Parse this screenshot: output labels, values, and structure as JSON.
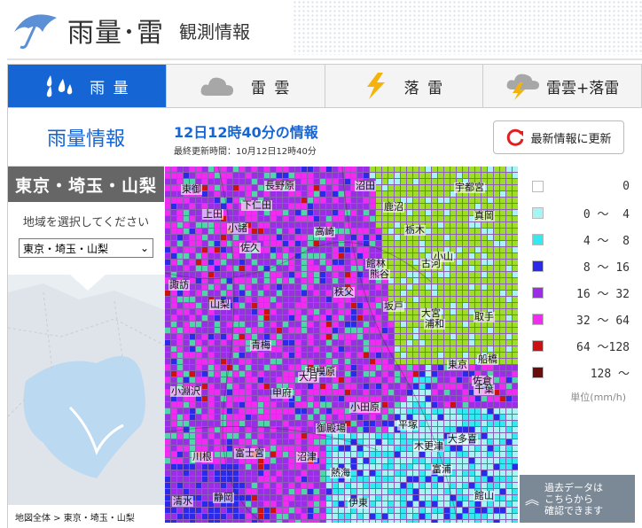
{
  "header": {
    "title": "雨量･雷",
    "subtitle": "観測情報"
  },
  "tabs": [
    {
      "label": "雨 量",
      "icon": "rain-drops-icon",
      "active": true
    },
    {
      "label": "雷 雲",
      "icon": "cloud-icon",
      "active": false
    },
    {
      "label": "落 雷",
      "icon": "lightning-icon",
      "active": false
    },
    {
      "label": "雷雲+落雷",
      "icon": "cloud-lightning-icon",
      "active": false
    }
  ],
  "sidebar": {
    "title": "雨量情報",
    "region": "東京・埼玉・山梨",
    "choose_label": "地域を選択してください",
    "select_value": "東京・埼玉・山梨",
    "breadcrumb": "地図全体 > 東京・埼玉・山梨"
  },
  "info": {
    "datetime": "12日12時40分の情報",
    "updated": "最終更新時間：10月12日12時40分",
    "refresh_label": "最新情報に更新"
  },
  "map_places": [
    "東御",
    "長野原",
    "沼田",
    "宇都宮",
    "上田",
    "下仁田",
    "鹿沼",
    "真岡",
    "小諸",
    "佐久",
    "高崎",
    "栃木",
    "小山",
    "古河",
    "館林",
    "熊谷",
    "諏訪",
    "秩父",
    "坂戸",
    "取手",
    "大宮",
    "浦和",
    "船橋",
    "佐倉",
    "山梨",
    "青梅",
    "東京",
    "千葉",
    "富士宮",
    "相模原",
    "小田原",
    "平塚",
    "御殿場",
    "沼津",
    "熱海",
    "清水",
    "静岡",
    "伊東",
    "富浦",
    "館山",
    "川根",
    "大月",
    "甲府",
    "大多喜",
    "小淵沢",
    "木更津"
  ],
  "legend": {
    "items": [
      {
        "label": "0",
        "color": "#ffffff"
      },
      {
        "label": "0 ～  4",
        "color": "#a8f4f4"
      },
      {
        "label": "4 ～  8",
        "color": "#33e8ee"
      },
      {
        "label": "8 ～ 16",
        "color": "#2a2ae8"
      },
      {
        "label": "16 ～ 32",
        "color": "#9b2de6"
      },
      {
        "label": "32 ～ 64",
        "color": "#f02cf0"
      },
      {
        "label": "64 ～128",
        "color": "#cc1111"
      },
      {
        "label": "128 ～",
        "color": "#6a0d0d"
      }
    ],
    "unit": "単位(mm/h)",
    "past_data_label": "過去データは\nこちらから\n確認できます"
  }
}
